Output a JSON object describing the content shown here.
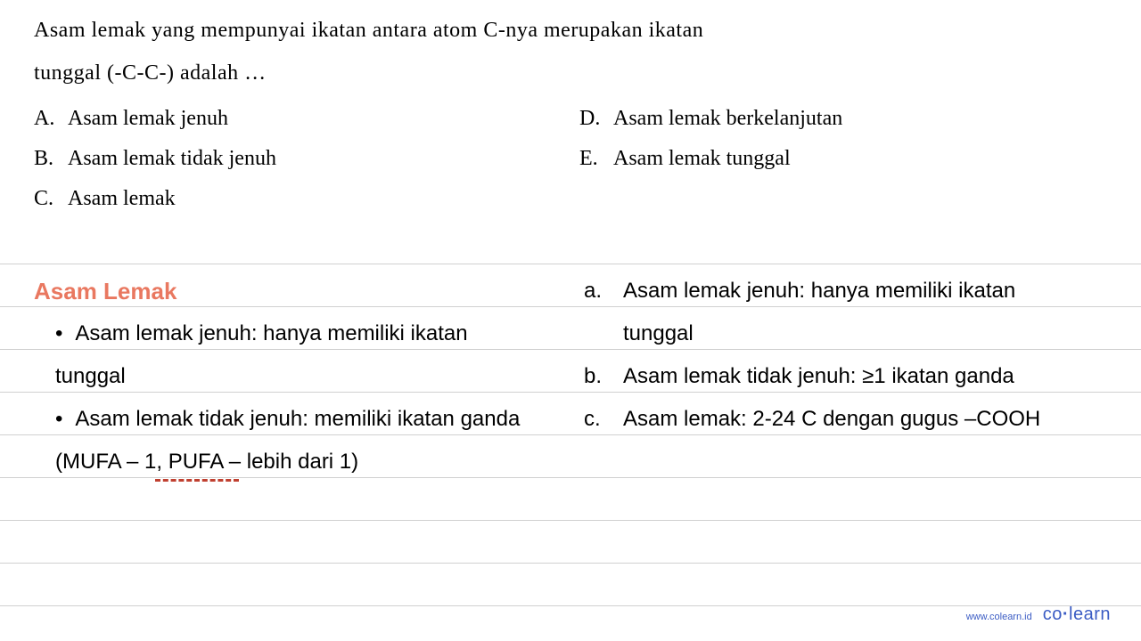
{
  "question": {
    "line1": "Asam  lemak  yang mempunyai  ikatan  antara  atom  C-nya  merupakan  ikatan",
    "line2": "tunggal (-C-C-) adalah …"
  },
  "options": {
    "a": {
      "label": "A.",
      "text": "Asam lemak jenuh"
    },
    "b": {
      "label": "B.",
      "text": "Asam lemak tidak jenuh"
    },
    "c": {
      "label": "C.",
      "text": "Asam lemak"
    },
    "d": {
      "label": "D.",
      "text": "Asam lemak berkelanjutan"
    },
    "e": {
      "label": "E.",
      "text": "Asam lemak tunggal"
    }
  },
  "notes": {
    "title": "Asam Lemak",
    "left_bullets": [
      {
        "line1": "Asam lemak jenuh: hanya memiliki ikatan",
        "line2": "tunggal"
      },
      {
        "line1": "Asam lemak tidak jenuh: memiliki ikatan ganda",
        "line2": "(MUFA – 1, PUFA – lebih dari 1)"
      }
    ],
    "right_letters": [
      {
        "label": "a.",
        "line1": "Asam lemak jenuh: hanya memiliki ikatan",
        "line2": "tunggal"
      },
      {
        "label": "b.",
        "line1": "Asam lemak tidak jenuh: ≥1 ikatan ganda",
        "line2": ""
      },
      {
        "label": "c.",
        "line1": "Asam lemak: 2-24 C dengan gugus –COOH",
        "line2": ""
      }
    ]
  },
  "footer": {
    "url": "www.colearn.id",
    "logo_part1": "co",
    "logo_dot": "·",
    "logo_part2": "learn"
  }
}
